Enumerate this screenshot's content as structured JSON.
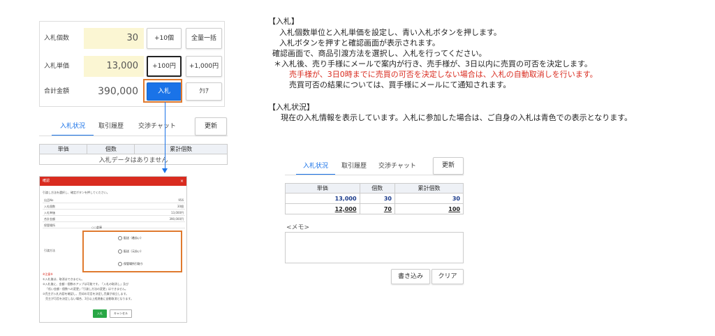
{
  "bid_form": {
    "count_label": "入札個数",
    "count_value": "30",
    "add10_label": "+10個",
    "buyall_label": "全量一括",
    "price_label": "入札単価",
    "price_value": "13,000",
    "add100_label": "+100円",
    "add1000_label": "+1,000円",
    "total_label": "合計金額",
    "total_value": "390,000",
    "submit_label": "入札",
    "clear_label": "ｸﾘｱ"
  },
  "left_tabs": {
    "bid_status": "入札状況",
    "history": "取引履歴",
    "chat": "交渉チャット",
    "refresh": "更新"
  },
  "left_table": {
    "headers": [
      "単価",
      "個数",
      "累計個数"
    ],
    "empty": "入札データはありません"
  },
  "dialog": {
    "title": "確認",
    "close": "×",
    "intro": "引渡し方法を選択し、確定ボタンを押してください。",
    "rows": [
      {
        "k": "出品No",
        "v": "956"
      },
      {
        "k": "入札個数",
        "v": "30個"
      },
      {
        "k": "入札単価",
        "v": "13,000円"
      },
      {
        "k": "合計金額",
        "v": "390,000円"
      },
      {
        "k": "保管場所",
        "v": ""
      }
    ],
    "method_label": "引渡方法",
    "store_value": "○○倉庫",
    "options": [
      "配送（着払い）",
      "配送（元払い）",
      "保管場所引取り"
    ],
    "notice_title": "※注意※",
    "notices": [
      "①入札後は、取消はできません。",
      "②入札後に、金額・個数のアップは可能です。「入札の取消し」及び",
      "「低い金額・個数への変更」「引渡し方法の変更」はできません。",
      "③売主が入札内容を確認し、売却の可否を決定し売買が成立します。",
      "売主が可否を決定しない場合、3日以上経過後に自動取消となります。"
    ],
    "ok_label": "入札",
    "cancel_label": "キャンセル"
  },
  "explain": {
    "bid_heading": "【入札】",
    "bid_lines": [
      "入札個数単位と入札単価を設定し、青い入札ボタンを押します。",
      "入札ボタンを押すと確認画面が表示されます。",
      "確認画面で、商品引渡方法を選択し、入札を行ってください。",
      "＊入札後、売り手様にメールで案内が行き、売手様が、3日以内に売買の可否を決定します。"
    ],
    "bid_warning": "売手様が、3日0時までに売買の可否を決定しない場合は、入札の自動取消しを行います。",
    "bid_result": "売買可否の結果については、買手様にメールにて通知されます。",
    "status_heading": "【入札状況】",
    "status_line": "現在の入札情報を表示しています。入札に参加した場合は、ご自身の入札は青色での表示となります。"
  },
  "right_tabs": {
    "bid_status": "入札状況",
    "history": "取引履歴",
    "chat": "交渉チャット",
    "refresh": "更新"
  },
  "right_table": {
    "headers": [
      "単価",
      "個数",
      "累計個数"
    ],
    "rows": [
      [
        "13,000",
        "30",
        "30"
      ],
      [
        "12,000",
        "70",
        "100"
      ]
    ]
  },
  "memo": {
    "label": "<メモ>",
    "write_label": "書き込み",
    "clear_label": "クリア"
  },
  "colors": {
    "accent_blue": "#1a73e8",
    "highlight_orange": "#e07a2e",
    "warning_red": "#d92b1f",
    "input_yellow": "#fbf6d3"
  }
}
